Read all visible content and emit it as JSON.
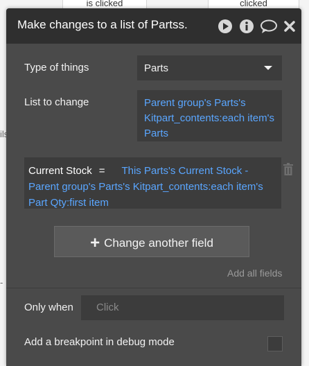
{
  "background": {
    "left_card_text": "is clicked",
    "right_card_text": "clicked",
    "edge_text_1": "ils",
    "edge_text_2": "-"
  },
  "panel": {
    "title": "Make changes to a list of Partss.",
    "icons": [
      "play-icon",
      "info-icon",
      "comment-icon",
      "close-icon"
    ]
  },
  "form": {
    "type_label": "Type of things",
    "type_value": "Parts",
    "list_label": "List to change",
    "list_value": "Parent group's Parts's Kitpart_contents:each item's Parts",
    "field": {
      "name": "Current Stock",
      "operator": "=",
      "expression": "This Parts's Current Stock - Parent group's Parts's Kitpart_contents:each item's Part Qty:first item"
    },
    "change_field_button": "Change another field",
    "add_all_fields": "Add all fields",
    "only_when_label": "Only when",
    "only_when_placeholder": "Click",
    "breakpoint_label": "Add a breakpoint in debug mode",
    "breakpoint_checked": false
  },
  "colors": {
    "panel_bg": "#4a4a4a",
    "titlebar_bg": "#2f2f2f",
    "input_bg": "#3c3c3c",
    "expression_blue": "#5aa6ff"
  }
}
